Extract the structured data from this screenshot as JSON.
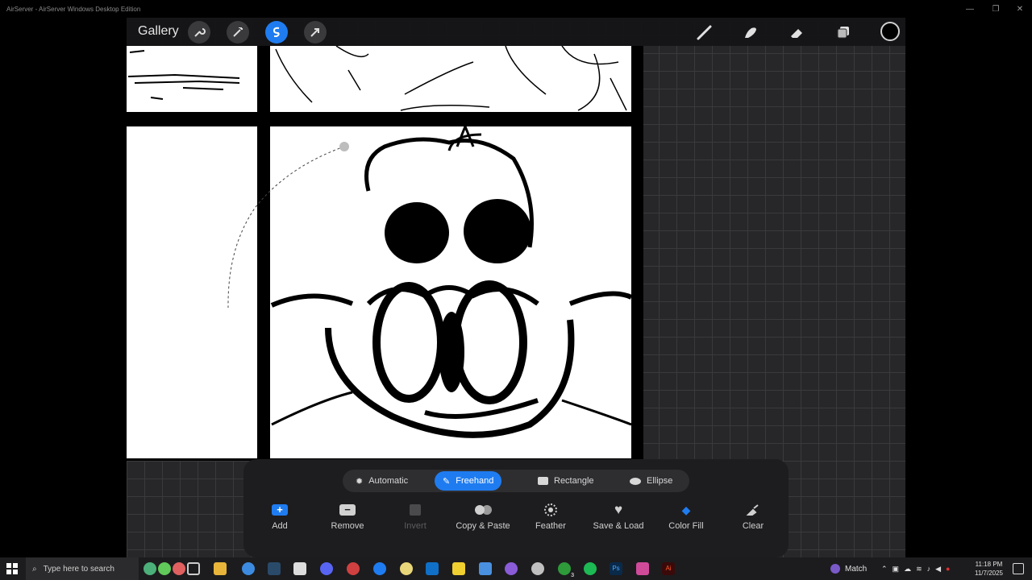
{
  "window": {
    "title": "AirServer - AirServer Windows Desktop Edition"
  },
  "topbar": {
    "gallery_label": "Gallery",
    "left_tools": [
      "wrench-icon",
      "magic-wand-icon",
      "selection-icon",
      "arrow-transform-icon"
    ],
    "right_tools": [
      "brush-icon",
      "smudge-icon",
      "eraser-icon",
      "layers-icon"
    ],
    "active_tool": "selection-icon",
    "current_color": "#000000"
  },
  "selection": {
    "modes": [
      {
        "label": "Automatic",
        "icon": "sparkle-icon"
      },
      {
        "label": "Freehand",
        "icon": "freehand-icon"
      },
      {
        "label": "Rectangle",
        "icon": "rectangle-icon"
      },
      {
        "label": "Ellipse",
        "icon": "ellipse-icon"
      }
    ],
    "active_mode": "Freehand",
    "operations": [
      {
        "label": "Add",
        "icon": "plus-icon",
        "enabled": true
      },
      {
        "label": "Remove",
        "icon": "minus-icon",
        "enabled": true
      },
      {
        "label": "Invert",
        "icon": "invert-icon",
        "enabled": false
      },
      {
        "label": "Copy & Paste",
        "icon": "copy-paste-icon",
        "enabled": true
      },
      {
        "label": "Feather",
        "icon": "feather-icon",
        "enabled": true
      },
      {
        "label": "Save & Load",
        "icon": "heart-icon",
        "enabled": true
      },
      {
        "label": "Color Fill",
        "icon": "color-fill-icon",
        "enabled": true
      },
      {
        "label": "Clear",
        "icon": "clear-icon",
        "enabled": true
      }
    ]
  },
  "taskbar": {
    "search_placeholder": "Type here to search",
    "tray_label": "Match",
    "time": "11:18 PM",
    "date": "11/7/2025",
    "notification_count": "3"
  },
  "colors": {
    "accent": "#1f7cf0",
    "panel": "#1d1d1f",
    "background": "#27272a"
  }
}
